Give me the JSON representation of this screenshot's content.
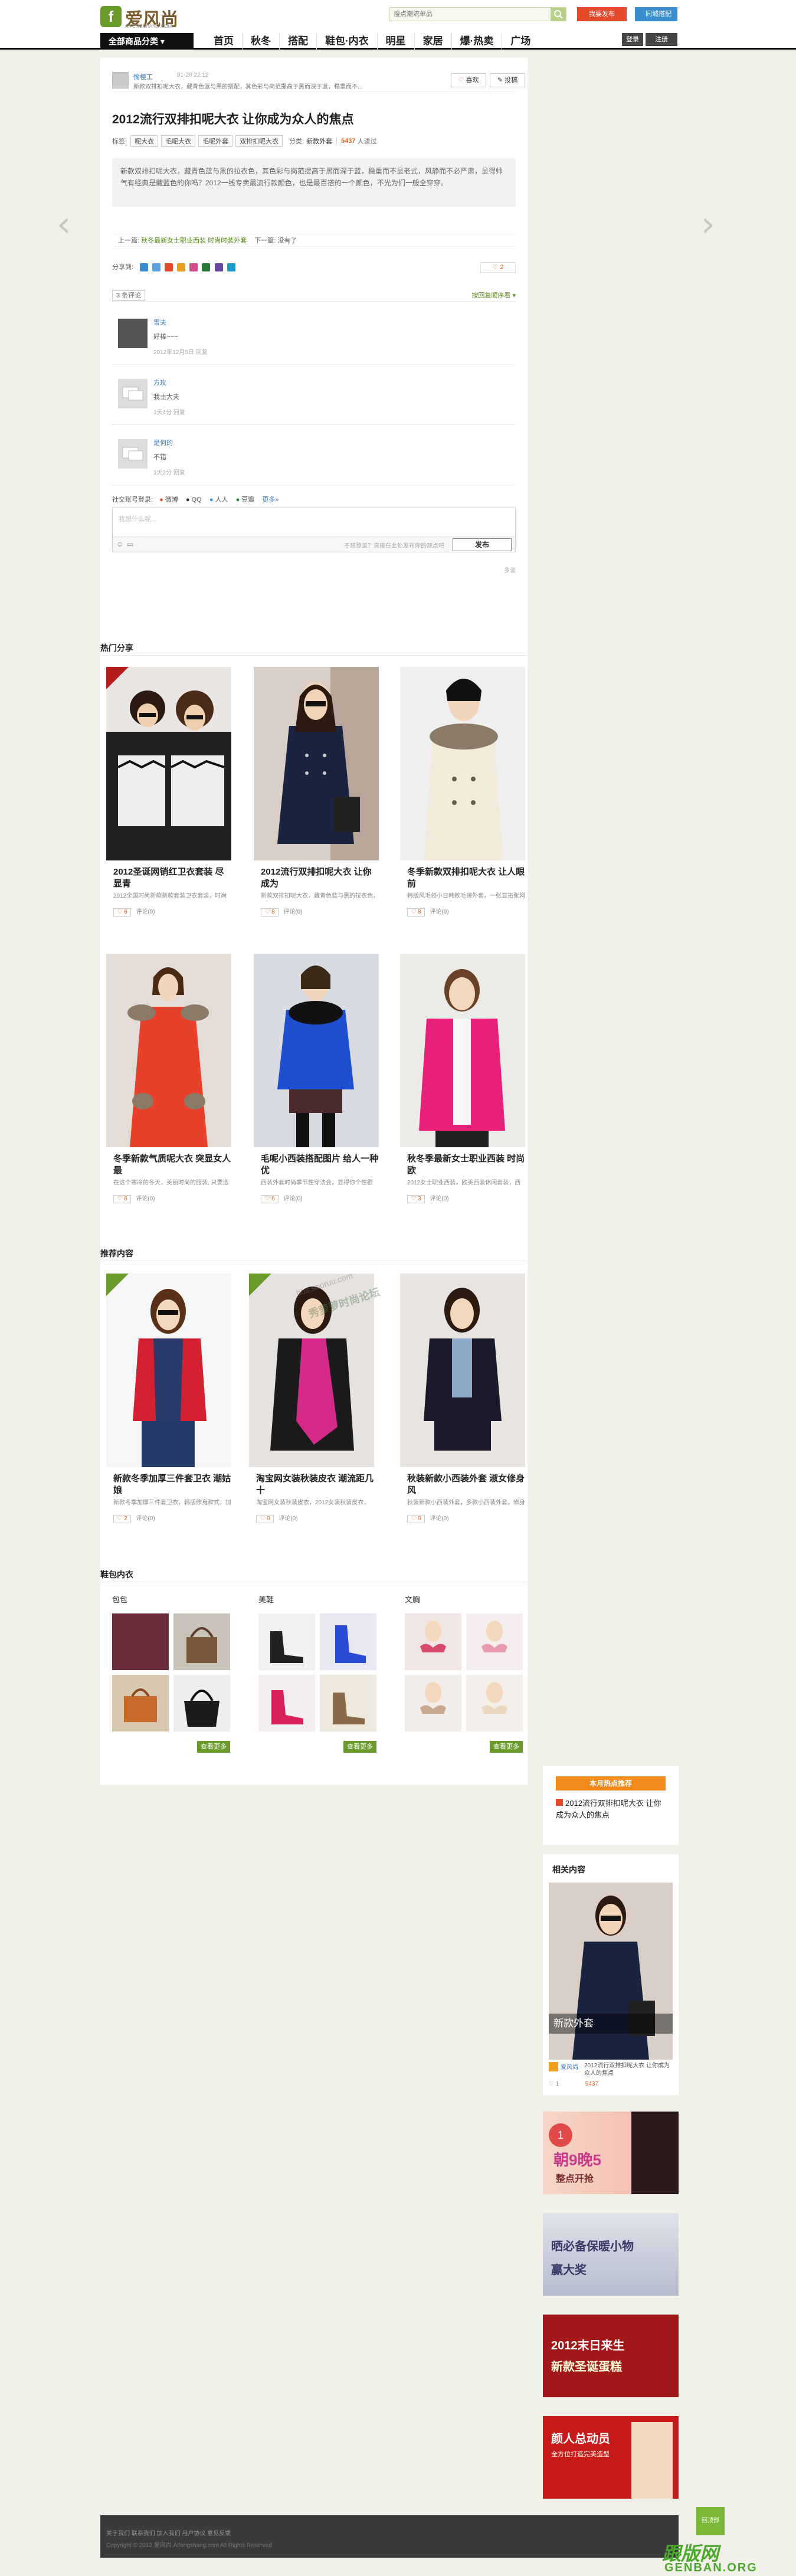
{
  "site": {
    "logo_text": "爱风尚",
    "logo_sub": "AIFENGSHANG.COM",
    "search_placeholder": "搜点潮流单品",
    "publish_label": "我要发布",
    "local_label": "同城搭配",
    "catalog_label": "全部商品分类",
    "nav": [
      "首页",
      "秋冬",
      "搭配",
      "鞋包·内衣",
      "明星",
      "家居",
      "爆·热卖",
      "广场"
    ],
    "login": "登录",
    "register": "注册"
  },
  "post": {
    "author": "愉樱工",
    "date": "01-28 22:12",
    "source_line": "新款双排扣呢大衣，藏青色蓝与黑的搭配，其色彩与岗范提高于黑而深于蓝，稳重而不...",
    "collect": "喜欢",
    "report": "投稿",
    "title": "2012流行双排扣呢大衣 让你成为众人的焦点",
    "tags_label": "标签:",
    "tags": [
      "呢大衣",
      "毛呢大衣",
      "毛呢外套",
      "双排扣呢大衣"
    ],
    "category_label": "分类:",
    "category": "新款外套",
    "views": "5437",
    "views_label": "人读过",
    "summary": "新款双排扣呢大衣，藏青色蓝与黑的拉衣色，其色彩与岗范提高于黑而深于蓝，稳重而不显老式，风静而不必严肃，显得帅气有经典是藏蓝色的你吗？2012一线专卖最流行款颜色，也是最百搭的一个颜色，不光为们一般全穿穿。",
    "prev_label": "上一篇:",
    "prev_link": "秋冬最新女士职业西装 时尚时装外套",
    "next_label": "下一篇:",
    "next_link": "没有了",
    "share_label": "分享到:",
    "fav_count": "2"
  },
  "comments": {
    "count_label": "3 条评论",
    "sort_label": "按回复顺序看",
    "items": [
      {
        "name": "雪夫",
        "text": "好棒~~~",
        "meta": "2012年12月5日  回复"
      },
      {
        "name": "方玫",
        "text": "我士大夫",
        "meta": "1天4分  回复"
      },
      {
        "name": "是何的",
        "text": "不错",
        "meta": "1天2分  回复"
      }
    ],
    "social_label": "社交账号登录:",
    "social": [
      "微博",
      "QQ",
      "人人",
      "豆瓣",
      "更多»"
    ],
    "input_placeholder": "我想什么呢...",
    "tip": "不想登录？直接在此处发布你的观点吧",
    "send": "发布",
    "page": "多谈"
  },
  "hot": {
    "title": "热门分享",
    "items": [
      {
        "title": "2012圣诞网销红卫衣套装 尽显青",
        "desc": "2012全国时尚新款新款套装卫衣套装，时尚加圆款新款套装卫衣外套",
        "likes": "6",
        "comments": "评论(0)"
      },
      {
        "title": "2012流行双排扣呢大衣 让你成为",
        "desc": "新款双排扣呢大衣，藏青色蓝与黑的拉衣色，其色彩与岗范提高于",
        "likes": "8",
        "comments": "评论(0)"
      },
      {
        "title": "冬季新款双排扣呢大衣 让人眼前",
        "desc": "韩版风毛领小日韩款毛领外套，一张显拓张网站领帽子，来有魔力而抵",
        "likes": "8",
        "comments": "评论(0)"
      },
      {
        "title": "冬季新款气质呢大衣 突显女人最",
        "desc": "在这个寒冷的冬天，美丽时尚的服装, 只要选对的搭配，指南大衣",
        "likes": "6",
        "comments": "评论(0)"
      },
      {
        "title": "毛呢小西装搭配图片 给人一种优",
        "desc": "西装外套时尚季节性穿法会，显得你个性很高，穿出自己的一种女人味",
        "likes": "6",
        "comments": "评论(0)"
      },
      {
        "title": "秋冬季最新女士职业西装 时尚欧",
        "desc": "2012女士职业西装，欧美西装休闲套装，西装套装的人气气质, 欧美款",
        "likes": "3",
        "comments": "评论(0)"
      }
    ]
  },
  "rec": {
    "title": "推荐内容",
    "items": [
      {
        "title": "新款冬季加厚三件套卫衣 潮姑娘",
        "desc": "新款冬季加厚三件套卫衣，韩版修身款式，加厚卫衣套装",
        "likes": "2",
        "comments": "评论(0)"
      },
      {
        "title": "淘宝网女装秋装皮衣 潮流距几十",
        "desc": "淘宝网女装秋装皮衣，2012女装秋装皮衣，个性皮衣外套",
        "likes": "0",
        "comments": "评论(0)"
      },
      {
        "title": "秋装新款小西装外套 淑女修身风",
        "desc": "秋装新款小西装外套，多款小西装外套，修身淑女风的款式",
        "likes": "0",
        "comments": "评论(0)"
      }
    ],
    "photo_watermark": "bbs.sooruu.com",
    "photo_watermark2": "秀萝萝时尚论坛"
  },
  "bags": {
    "title": "鞋包内衣",
    "cols": [
      "包包",
      "美鞋",
      "文胸"
    ],
    "more": "查看更多"
  },
  "sidebar": {
    "hot_banner": "本月热点推荐",
    "hot_item": "2012流行双排扣呢大衣 让你成为众人的焦点",
    "related_title": "相关内容",
    "related_item": "新款外套",
    "related_author": "爱风尚",
    "related_desc": "2012流行双排扣呢大衣 让你成为众人的焦点",
    "related_likes": "1",
    "related_views": "5437",
    "ads": [
      {
        "text": "朝9晚5",
        "sub": "整点开抢"
      },
      {
        "text": "晒必备保暖小物",
        "sub": "赢大奖"
      },
      {
        "text": "2012末日来生",
        "sub": "新款圣诞蛋糕"
      },
      {
        "text": "颜人总动员",
        "sub": "全方位打造完美造型"
      }
    ]
  },
  "footer": {
    "links": "关于我们   联系我们   加入我们   用户协议   意见反馈",
    "copy": "Copyright © 2012 爱风尚 Aifengshang.com All Rights Reserved"
  },
  "gotop": "回顶部",
  "watermark": {
    "main": "跟版网",
    "sub": "GENBAN.ORG"
  }
}
